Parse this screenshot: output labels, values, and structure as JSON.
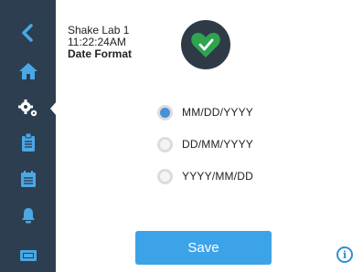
{
  "header": {
    "device_name": "Shake Lab 1",
    "time": "11:22:24AM",
    "page_title": "Date Format"
  },
  "status_icon": "heart-check-icon",
  "sidebar": {
    "items": [
      {
        "name": "back",
        "icon": "chevron-left-icon"
      },
      {
        "name": "home",
        "icon": "home-icon"
      },
      {
        "name": "settings",
        "icon": "gears-icon",
        "active": true
      },
      {
        "name": "protocols",
        "icon": "clipboard-icon"
      },
      {
        "name": "schedule",
        "icon": "calendar-icon"
      },
      {
        "name": "alarms",
        "icon": "bell-icon"
      },
      {
        "name": "log",
        "icon": "film-icon"
      }
    ]
  },
  "date_format": {
    "options": [
      "MM/DD/YYYY",
      "DD/MM/YYYY",
      "YYYY/MM/DD"
    ],
    "selected": "MM/DD/YYYY"
  },
  "actions": {
    "save_label": "Save",
    "info_label": "i"
  },
  "colors": {
    "sidebar_bg": "#2c3e50",
    "accent_blue": "#3da3e8",
    "nav_icon_blue": "#4aa8e6",
    "badge_green": "#2ea44f"
  }
}
